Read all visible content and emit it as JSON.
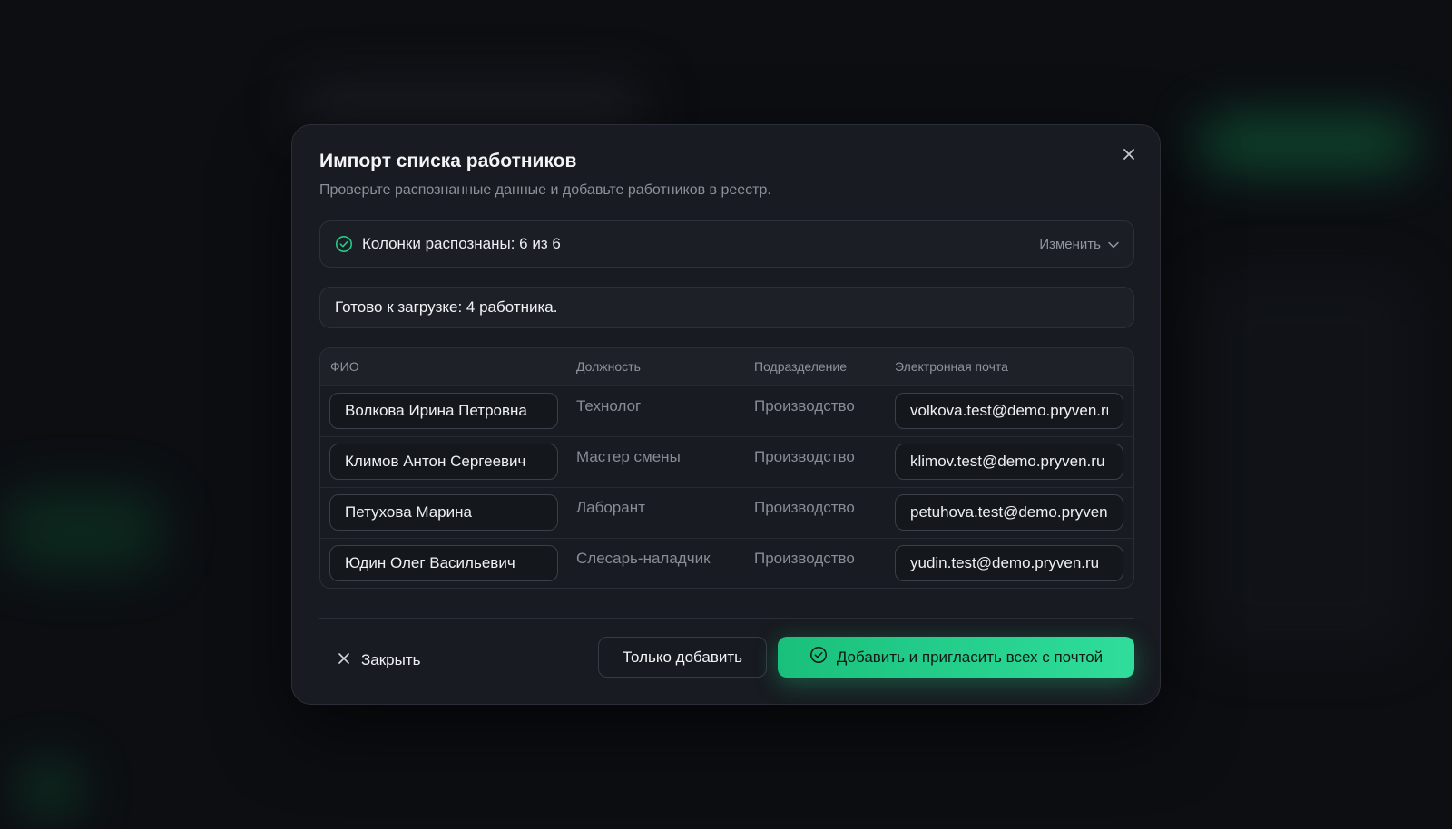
{
  "colors": {
    "accent": "#22cc85",
    "surface": "#181b21",
    "background": "#0c0e12"
  },
  "dialog": {
    "title": "Импорт списка работников",
    "subtitle": "Проверьте распознанные данные и добавьте работников в реестр.",
    "close_icon": "close-icon",
    "columns_status": {
      "icon": "check-circle-icon",
      "label": "Колонки распознаны: 6 из 6",
      "change_label": "Изменить",
      "change_icon": "chevron-down-icon"
    },
    "ready_text": "Готово к загрузке: 4 работника.",
    "table": {
      "headers": [
        "ФИО",
        "Должность",
        "Подразделение",
        "Электронная почта"
      ],
      "rows": [
        {
          "name": "Волкова Ирина Петровна",
          "position": "Технолог",
          "department": "Производство",
          "email": "volkova.test@demo.pryven.ru"
        },
        {
          "name": "Климов Антон Сергеевич",
          "position": "Мастер смены",
          "department": "Производство",
          "email": "klimov.test@demo.pryven.ru"
        },
        {
          "name": "Петухова Марина",
          "position": "Лаборант",
          "department": "Производство",
          "email": "petuhova.test@demo.pryven.ru"
        },
        {
          "name": "Юдин Олег Васильевич",
          "position": "Слесарь-наладчик",
          "department": "Производство",
          "email": "yudin.test@demo.pryven.ru"
        }
      ]
    },
    "footer": {
      "close_label": "Закрыть",
      "only_add_label": "Только добавить",
      "invite_label": "Добавить и пригласить всех с почтой",
      "invite_icon": "check-circle-icon"
    }
  }
}
